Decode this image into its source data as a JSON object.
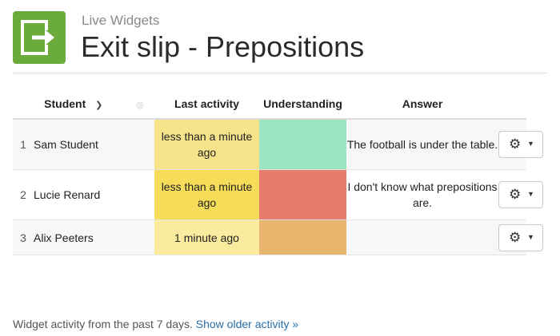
{
  "header": {
    "subtitle": "Live Widgets",
    "title": "Exit slip - Prepositions",
    "logo_icon": "exit-arrow-icon",
    "logo_color": "#6aab3c"
  },
  "table": {
    "columns": {
      "student": "Student",
      "last_activity": "Last activity",
      "understanding": "Understanding",
      "answer": "Answer"
    },
    "rows": [
      {
        "number": "1",
        "student": "Sam Student",
        "last_activity": "less than a minute ago",
        "last_activity_color": "#f7e48a",
        "understanding_color": "#9be4c0",
        "answer": "The football is under the table."
      },
      {
        "number": "2",
        "student": "Lucie Renard",
        "last_activity": "less than a minute ago",
        "last_activity_color": "#f6dd59",
        "understanding_color": "#e77b6e",
        "answer": "I don't know what prepositions are."
      },
      {
        "number": "3",
        "student": "Alix Peeters",
        "last_activity": "1 minute ago",
        "last_activity_color": "#faeb9e",
        "understanding_color": "#e9b66f",
        "answer": ""
      }
    ]
  },
  "footer": {
    "text": "Widget activity from the past 7 days.",
    "link": "Show older activity »"
  }
}
